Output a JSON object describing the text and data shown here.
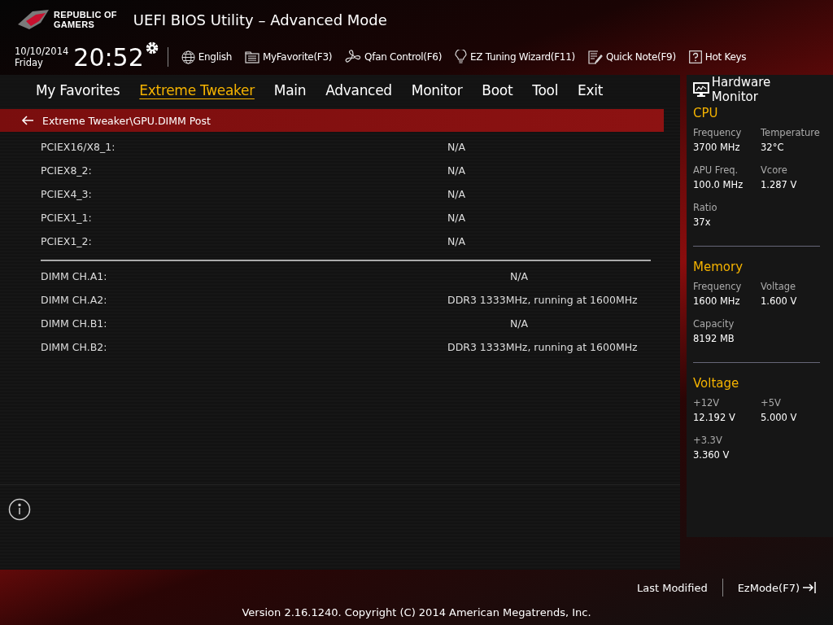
{
  "logo": {
    "line1": "REPUBLIC OF",
    "line2": "GAMERS"
  },
  "title": "UEFI BIOS Utility – Advanced Mode",
  "datetime": {
    "date": "10/10/2014",
    "day": "Friday",
    "time": "20:52"
  },
  "toolbar": [
    {
      "kind": "globe",
      "label": "English"
    },
    {
      "kind": "favorite",
      "label": "MyFavorite(F3)"
    },
    {
      "kind": "fan",
      "label": "Qfan Control(F6)"
    },
    {
      "kind": "bulb",
      "label": "EZ Tuning Wizard(F11)"
    },
    {
      "kind": "note",
      "label": "Quick Note(F9)"
    },
    {
      "kind": "help",
      "label": "Hot Keys"
    }
  ],
  "tabs": [
    {
      "label": "My Favorites",
      "selected": false
    },
    {
      "label": "Extreme Tweaker",
      "selected": true
    },
    {
      "label": "Main",
      "selected": false
    },
    {
      "label": "Advanced",
      "selected": false
    },
    {
      "label": "Monitor",
      "selected": false
    },
    {
      "label": "Boot",
      "selected": false
    },
    {
      "label": "Tool",
      "selected": false
    },
    {
      "label": "Exit",
      "selected": false
    }
  ],
  "breadcrumb": "Extreme Tweaker\\GPU.DIMM Post",
  "groups": [
    [
      {
        "label": "PCIEX16/X8_1:",
        "value": "N/A"
      },
      {
        "label": "PCIEX8_2:",
        "value": "N/A"
      },
      {
        "label": "PCIEX4_3:",
        "value": "N/A"
      },
      {
        "label": "PCIEX1_1:",
        "value": "N/A"
      },
      {
        "label": "PCIEX1_2:",
        "value": "N/A"
      }
    ],
    [
      {
        "label": "DIMM CH.A1:",
        "value": "N/A"
      },
      {
        "label": "DIMM CH.A2:",
        "value": "DDR3 1333MHz, running at 1600MHz"
      },
      {
        "label": "DIMM CH.B1:",
        "value": "N/A"
      },
      {
        "label": "DIMM CH.B2:",
        "value": "DDR3 1333MHz, running at 1600MHz"
      }
    ]
  ],
  "hardware_monitor": {
    "title": "Hardware Monitor",
    "sections": [
      {
        "title": "CPU",
        "items": [
          {
            "label": "Frequency",
            "value": "3700 MHz"
          },
          {
            "label": "Temperature",
            "value": "32°C"
          },
          {
            "label": "APU Freq.",
            "value": "100.0 MHz"
          },
          {
            "label": "Vcore",
            "value": "1.287 V"
          },
          {
            "label": "Ratio",
            "value": "37x"
          }
        ]
      },
      {
        "title": "Memory",
        "items": [
          {
            "label": "Frequency",
            "value": "1600 MHz"
          },
          {
            "label": "Voltage",
            "value": "1.600 V"
          },
          {
            "label": "Capacity",
            "value": "8192 MB"
          }
        ]
      },
      {
        "title": "Voltage",
        "items": [
          {
            "label": "+12V",
            "value": "12.192 V"
          },
          {
            "label": "+5V",
            "value": "5.000 V"
          },
          {
            "label": "+3.3V",
            "value": "3.360 V"
          }
        ]
      }
    ]
  },
  "footer": {
    "last_modified": "Last Modified",
    "ez_mode": "EzMode(F7)",
    "copyright": "Version 2.16.1240. Copyright (C) 2014 American Megatrends, Inc."
  }
}
